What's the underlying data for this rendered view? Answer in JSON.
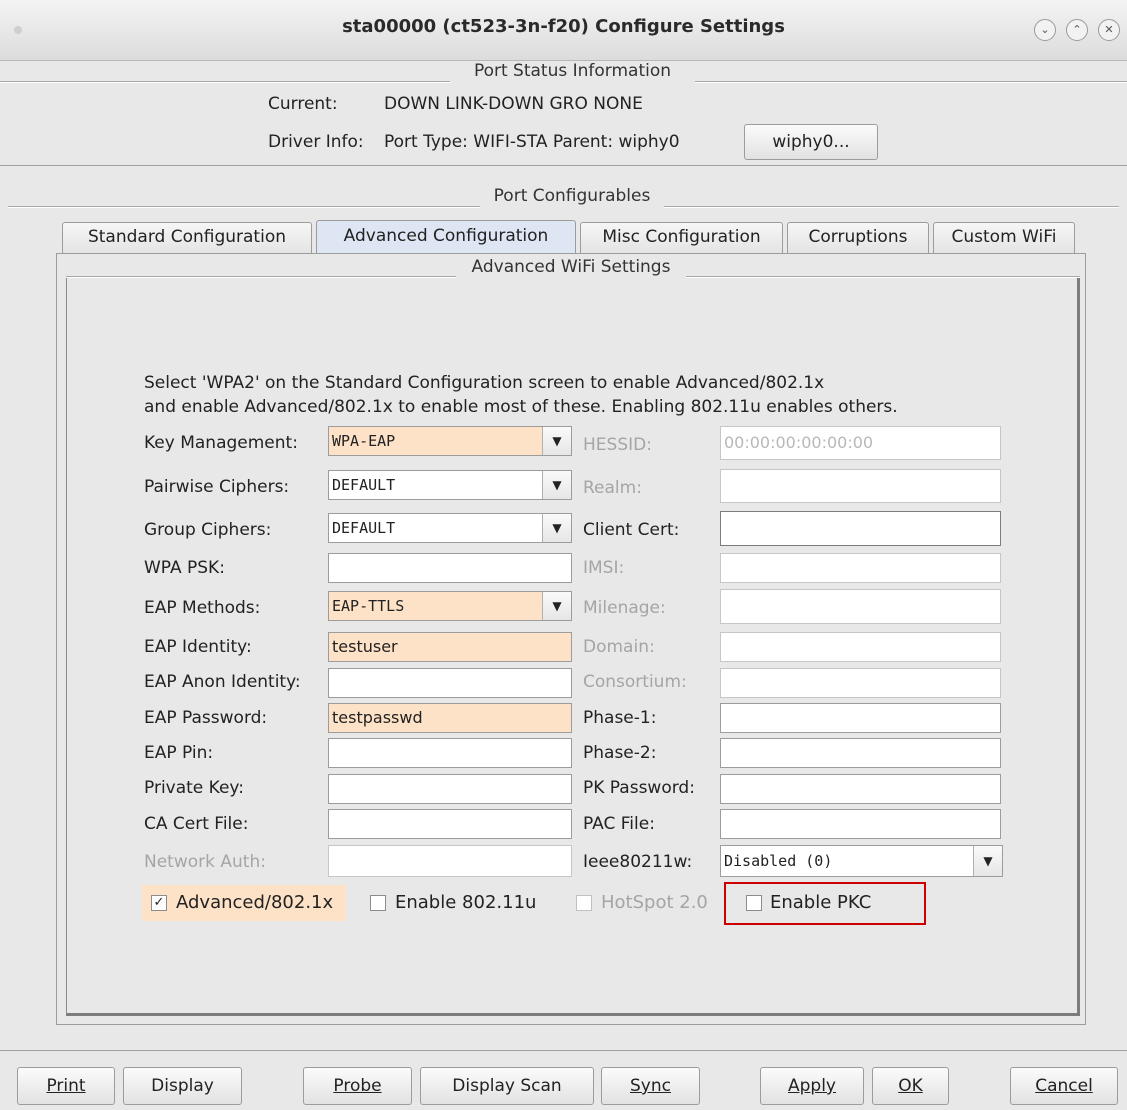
{
  "window": {
    "title": "sta00000  (ct523-3n-f20) Configure Settings",
    "controls": [
      "minimize-icon",
      "maximize-icon",
      "close-icon"
    ]
  },
  "port_status": {
    "group_title": "Port Status Information",
    "current_label": "Current:",
    "current_value": "DOWN LINK-DOWN GRO  NONE",
    "driver_label": "Driver Info:",
    "driver_value": "Port Type: WIFI-STA   Parent: wiphy0",
    "parent_button": "wiphy0..."
  },
  "configurables": {
    "group_title": "Port Configurables",
    "tabs": [
      "Standard Configuration",
      "Advanced Configuration",
      "Misc Configuration",
      "Corruptions",
      "Custom WiFi"
    ],
    "active_tab": "Advanced Configuration"
  },
  "advanced": {
    "group_title": "Advanced WiFi Settings",
    "info_line1": "Select 'WPA2' on the Standard Configuration screen to enable Advanced/802.1x",
    "info_line2": "and enable Advanced/802.1x to enable most of these. Enabling 802.11u enables others.",
    "left": {
      "key_mgmt_label": "Key Management:",
      "key_mgmt_value": "WPA-EAP",
      "pairwise_label": "Pairwise Ciphers:",
      "pairwise_value": "DEFAULT",
      "group_label": "Group Ciphers:",
      "group_value": "DEFAULT",
      "wpa_psk_label": "WPA PSK:",
      "wpa_psk_value": "",
      "eap_methods_label": "EAP Methods:",
      "eap_methods_value": "EAP-TTLS",
      "eap_identity_label": "EAP Identity:",
      "eap_identity_value": "testuser",
      "eap_anon_label": "EAP Anon Identity:",
      "eap_anon_value": "",
      "eap_password_label": "EAP Password:",
      "eap_password_value": "testpasswd",
      "eap_pin_label": "EAP Pin:",
      "eap_pin_value": "",
      "private_key_label": "Private Key:",
      "private_key_value": "",
      "ca_cert_label": "CA Cert File:",
      "ca_cert_value": "",
      "network_auth_label": "Network Auth:",
      "network_auth_value": ""
    },
    "right": {
      "hessid_label": "HESSID:",
      "hessid_value": "00:00:00:00:00:00",
      "realm_label": "Realm:",
      "realm_value": "",
      "client_cert_label": "Client Cert:",
      "client_cert_value": "",
      "imsi_label": "IMSI:",
      "imsi_value": "",
      "milenage_label": "Milenage:",
      "milenage_value": "",
      "domain_label": "Domain:",
      "domain_value": "",
      "consortium_label": "Consortium:",
      "consortium_value": "",
      "phase1_label": "Phase-1:",
      "phase1_value": "",
      "phase2_label": "Phase-2:",
      "phase2_value": "",
      "pk_password_label": "PK Password:",
      "pk_password_value": "",
      "pac_file_label": "PAC File:",
      "pac_file_value": "",
      "ieee80211w_label": "Ieee80211w:",
      "ieee80211w_value": "Disabled (0)"
    },
    "checkboxes": {
      "advanced_8021x": {
        "label": "Advanced/802.1x",
        "checked": true
      },
      "enable_80211u": {
        "label": "Enable 802.11u",
        "checked": false
      },
      "hotspot20": {
        "label": "HotSpot 2.0",
        "checked": false
      },
      "enable_pkc": {
        "label": "Enable PKC",
        "checked": false
      }
    },
    "highlight_color": "#cc0000",
    "changed_field_color": "#fde2c8"
  },
  "buttons": {
    "print": "Print",
    "display": "Display",
    "probe": "Probe",
    "display_scan": "Display Scan",
    "sync": "Sync",
    "apply": "Apply",
    "ok": "OK",
    "cancel": "Cancel"
  }
}
